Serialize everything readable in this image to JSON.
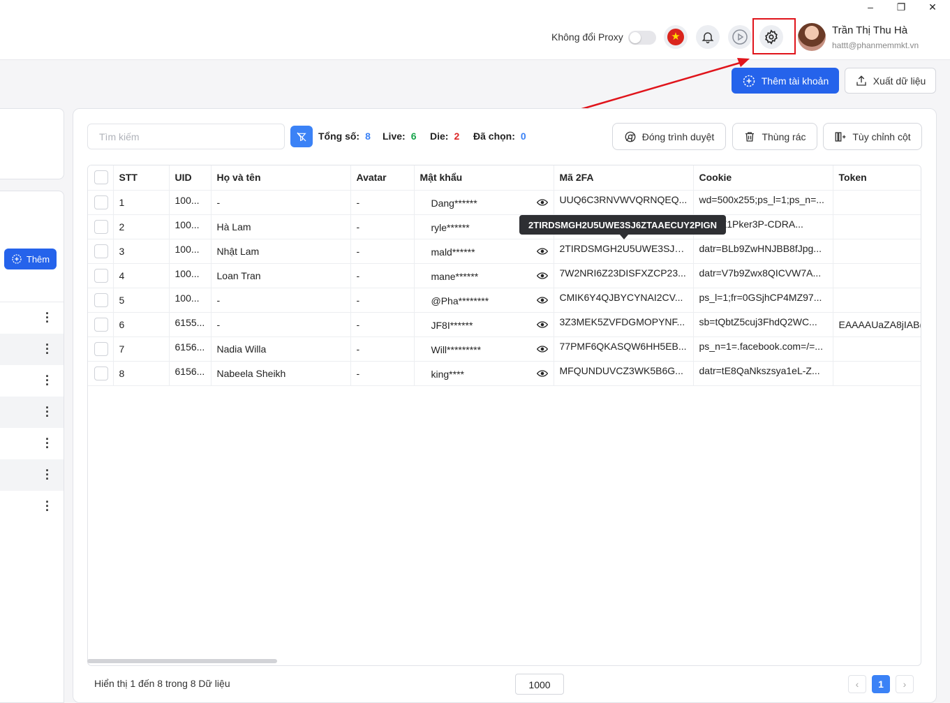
{
  "window": {
    "minimize": "–",
    "restore": "❐",
    "close": "✕"
  },
  "header": {
    "proxy_label": "Không đổi Proxy",
    "user_name": "Trần Thị Thu Hà",
    "user_email": "hattt@phanmemmkt.vn",
    "icons": [
      "vietnam-flag-icon",
      "bell-icon",
      "play-icon",
      "gear-icon"
    ]
  },
  "actions": {
    "add_account": "Thêm tài khoản",
    "export_data": "Xuất dữ liệu"
  },
  "sidebar": {
    "add_label": "Thêm"
  },
  "toolbar": {
    "search_placeholder": "Tìm kiếm",
    "total_label": "Tổng số:",
    "total_value": "8",
    "live_label": "Live:",
    "live_value": "6",
    "die_label": "Die:",
    "die_value": "2",
    "selected_label": "Đã chọn:",
    "selected_value": "0",
    "close_browser": "Đóng trình duyệt",
    "trash": "Thùng rác",
    "customize_columns": "Tùy chỉnh cột",
    "colors": {
      "total": "#3b82f6",
      "live": "#16a34a",
      "die": "#dc2626",
      "selected": "#3b82f6"
    }
  },
  "table": {
    "columns": [
      "STT",
      "UID",
      "Họ và tên",
      "Avatar",
      "Mật khẩu",
      "Mã 2FA",
      "Cookie",
      "Token"
    ],
    "rows": [
      {
        "stt": "1",
        "uid": "100...",
        "name": "-",
        "avatar": "-",
        "password": "Dang******",
        "twofa": "UUQ6C3RNVWVQRNQEQ...",
        "cookie": "wd=500x255;ps_l=1;ps_n=...",
        "token": ""
      },
      {
        "stt": "2",
        "uid": "100...",
        "name": "Hà Lam",
        "avatar": "-",
        "password": "ryle******",
        "twofa": "",
        "cookie": "3Lb9Z1Pker3P-CDRA...",
        "token": ""
      },
      {
        "stt": "3",
        "uid": "100...",
        "name": "Nhật Lam",
        "avatar": "-",
        "password": "mald******",
        "twofa": "2TIRDSMGH2U5UWE3SJ6...",
        "cookie": "datr=BLb9ZwHNJBB8fJpg...",
        "token": ""
      },
      {
        "stt": "4",
        "uid": "100...",
        "name": "Loan Tran",
        "avatar": "-",
        "password": "mane******",
        "twofa": "7W2NRI6Z23DISFXZCP23...",
        "cookie": "datr=V7b9Zwx8QICVW7A...",
        "token": ""
      },
      {
        "stt": "5",
        "uid": "100...",
        "name": "-",
        "avatar": "-",
        "password": "@Pha********",
        "twofa": "CMIK6Y4QJBYCYNAI2CV...",
        "cookie": "ps_l=1;fr=0GSjhCP4MZ97...",
        "token": ""
      },
      {
        "stt": "6",
        "uid": "6155...",
        "name": "-",
        "avatar": "-",
        "password": "JF8I******",
        "twofa": "3Z3MEK5ZVFDGMOPYNF...",
        "cookie": "sb=tQbtZ5cuj3FhdQ2WC...",
        "token": "EAAAAUaZA8jIAB("
      },
      {
        "stt": "7",
        "uid": "6156...",
        "name": "Nadia Willa",
        "avatar": "-",
        "password": "Will*********",
        "twofa": "77PMF6QKASQW6HH5EB...",
        "cookie": "ps_n=1=.facebook.com=/=...",
        "token": ""
      },
      {
        "stt": "8",
        "uid": "6156...",
        "name": "Nabeela Sheikh",
        "avatar": "-",
        "password": "king****",
        "twofa": "MFQUNDUVCZ3WK5B6G...",
        "cookie": "datr=tE8QaNkszsya1eL-Z...",
        "token": ""
      }
    ]
  },
  "tooltip": "2TIRDSMGH2U5UWE3SJ6ZTAAECUY2PIGN",
  "footer": {
    "summary": "Hiển thị 1 đến 8 trong 8 Dữ liệu",
    "page_size": "1000",
    "prev": "‹",
    "page": "1",
    "next": "›"
  }
}
